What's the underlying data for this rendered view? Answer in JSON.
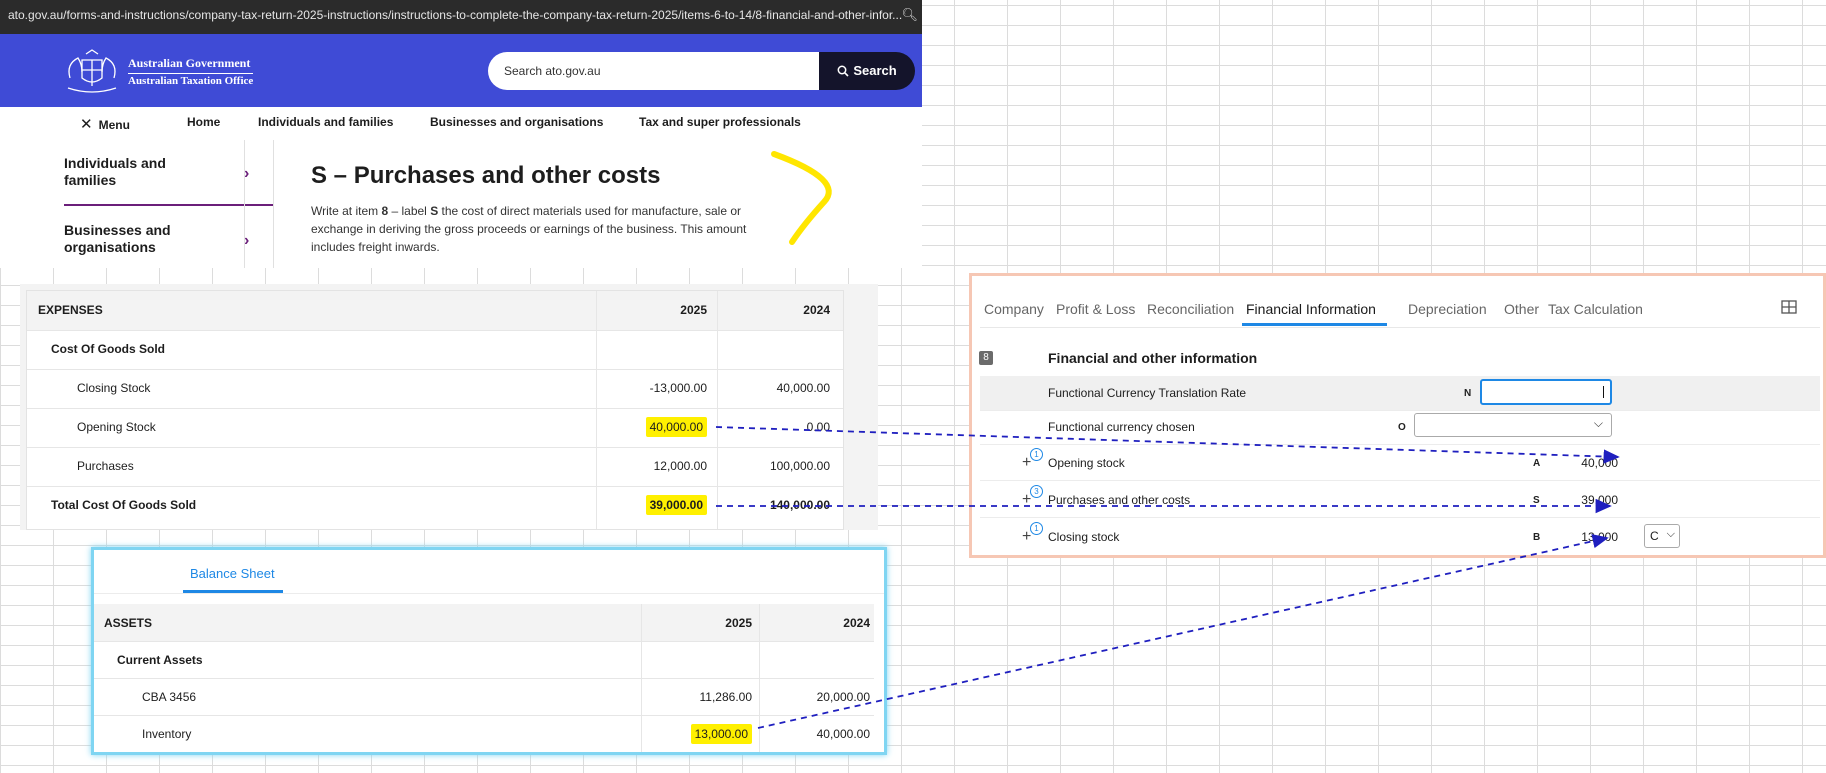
{
  "browser": {
    "url": "ato.gov.au/forms-and-instructions/company-tax-return-2025-instructions/instructions-to-complete-the-company-tax-return-2025/items-6-to-14/8-financial-and-other-infor..."
  },
  "ato": {
    "logo_line1": "Australian Government",
    "logo_line2": "Australian Taxation Office",
    "search_placeholder": "Search ato.gov.au",
    "search_button": "Search",
    "nav": {
      "menu": "Menu",
      "home": "Home",
      "individuals": "Individuals and families",
      "businesses": "Businesses and organisations",
      "tax_super": "Tax and super professionals"
    },
    "side": {
      "item1": "Individuals and families",
      "item2": "Businesses and organisations"
    },
    "heading": "S – Purchases and other costs",
    "para_part1": "Write at item ",
    "para_item": "8",
    "para_part2": " – label ",
    "para_label": "S",
    "para_part3": " the cost of direct materials used for manufacture, sale or exchange in deriving the gross proceeds or earnings of the business. This amount includes freight inwards."
  },
  "expenses": {
    "header": {
      "label": "EXPENSES",
      "col1": "2025",
      "col2": "2024"
    },
    "section": "Cost Of Goods Sold",
    "rows": [
      {
        "label": "Closing Stock",
        "v2025": "-13,000.00",
        "v2024": "40,000.00"
      },
      {
        "label": "Opening Stock",
        "v2025": "40,000.00",
        "v2024": "0.00"
      },
      {
        "label": "Purchases",
        "v2025": "12,000.00",
        "v2024": "100,000.00"
      }
    ],
    "total": {
      "label": "Total Cost Of Goods Sold",
      "v2025": "39,000.00",
      "v2024": "140,000.00"
    }
  },
  "balance_sheet": {
    "tab": "Balance Sheet",
    "header": {
      "label": "ASSETS",
      "col1": "2025",
      "col2": "2024"
    },
    "section": "Current Assets",
    "rows": [
      {
        "label": "CBA 3456",
        "v2025": "11,286.00",
        "v2024": "20,000.00"
      },
      {
        "label": "Inventory",
        "v2025": "13,000.00",
        "v2024": "40,000.00"
      }
    ]
  },
  "tax_app": {
    "tabs": [
      "Company",
      "Profit & Loss",
      "Reconciliation",
      "Financial Information",
      "Depreciation",
      "Other",
      "Tax Calculation"
    ],
    "active_tab": "Financial Information",
    "item_number": "8",
    "heading": "Financial and other information",
    "rows": {
      "rate": {
        "label": "Functional Currency Translation Rate",
        "code": "N",
        "value": ""
      },
      "currency": {
        "label": "Functional currency chosen",
        "code": "O",
        "value": ""
      },
      "opening": {
        "label": "Opening stock",
        "code": "A",
        "value": "40,000",
        "badge": "1"
      },
      "purchases": {
        "label": "Purchases and other costs",
        "code": "S",
        "value": "39,000",
        "badge": "3"
      },
      "closing": {
        "label": "Closing stock",
        "code": "B",
        "value": "13,000",
        "badge": "1",
        "select": "C"
      }
    }
  },
  "colors": {
    "ato_blue": "#3f4bd6",
    "highlight": "#fff000",
    "arrow": "#1f1fbf",
    "tab_accent": "#1e88e5"
  }
}
